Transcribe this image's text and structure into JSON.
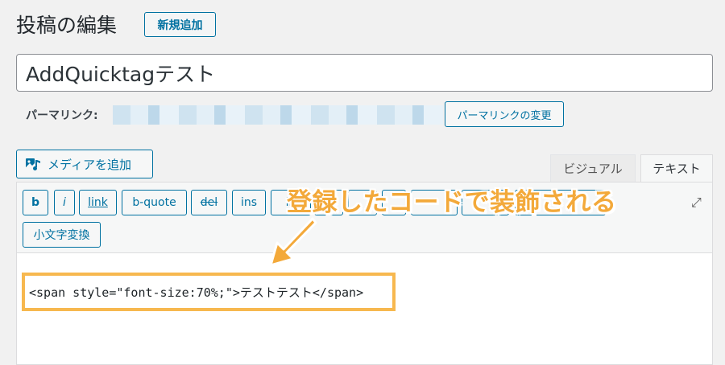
{
  "header": {
    "title": "投稿の編集",
    "add_new_label": "新規追加"
  },
  "post": {
    "title_value": "AddQuicktagテスト"
  },
  "permalink": {
    "label": "パーマリンク:",
    "edit_button_label": "パーマリンクの変更"
  },
  "media": {
    "add_media_label": "メディアを追加",
    "icon": "media-icon"
  },
  "editor_tabs": {
    "visual_label": "ビジュアル",
    "text_label": "テキスト",
    "active": "text"
  },
  "quicktags": {
    "buttons": [
      "b",
      "i",
      "link",
      "b-quote",
      "del",
      "ins",
      "in"
    ],
    "custom_button": "小文字変換"
  },
  "editor": {
    "content": "<span style=\"font-size:70%;\">テストテスト</span>"
  },
  "annotation": {
    "text": "登録したコードで装飾される",
    "color": "#f3a93a"
  },
  "colors": {
    "accent": "#0071a1",
    "highlight_border": "#f7b84f"
  }
}
